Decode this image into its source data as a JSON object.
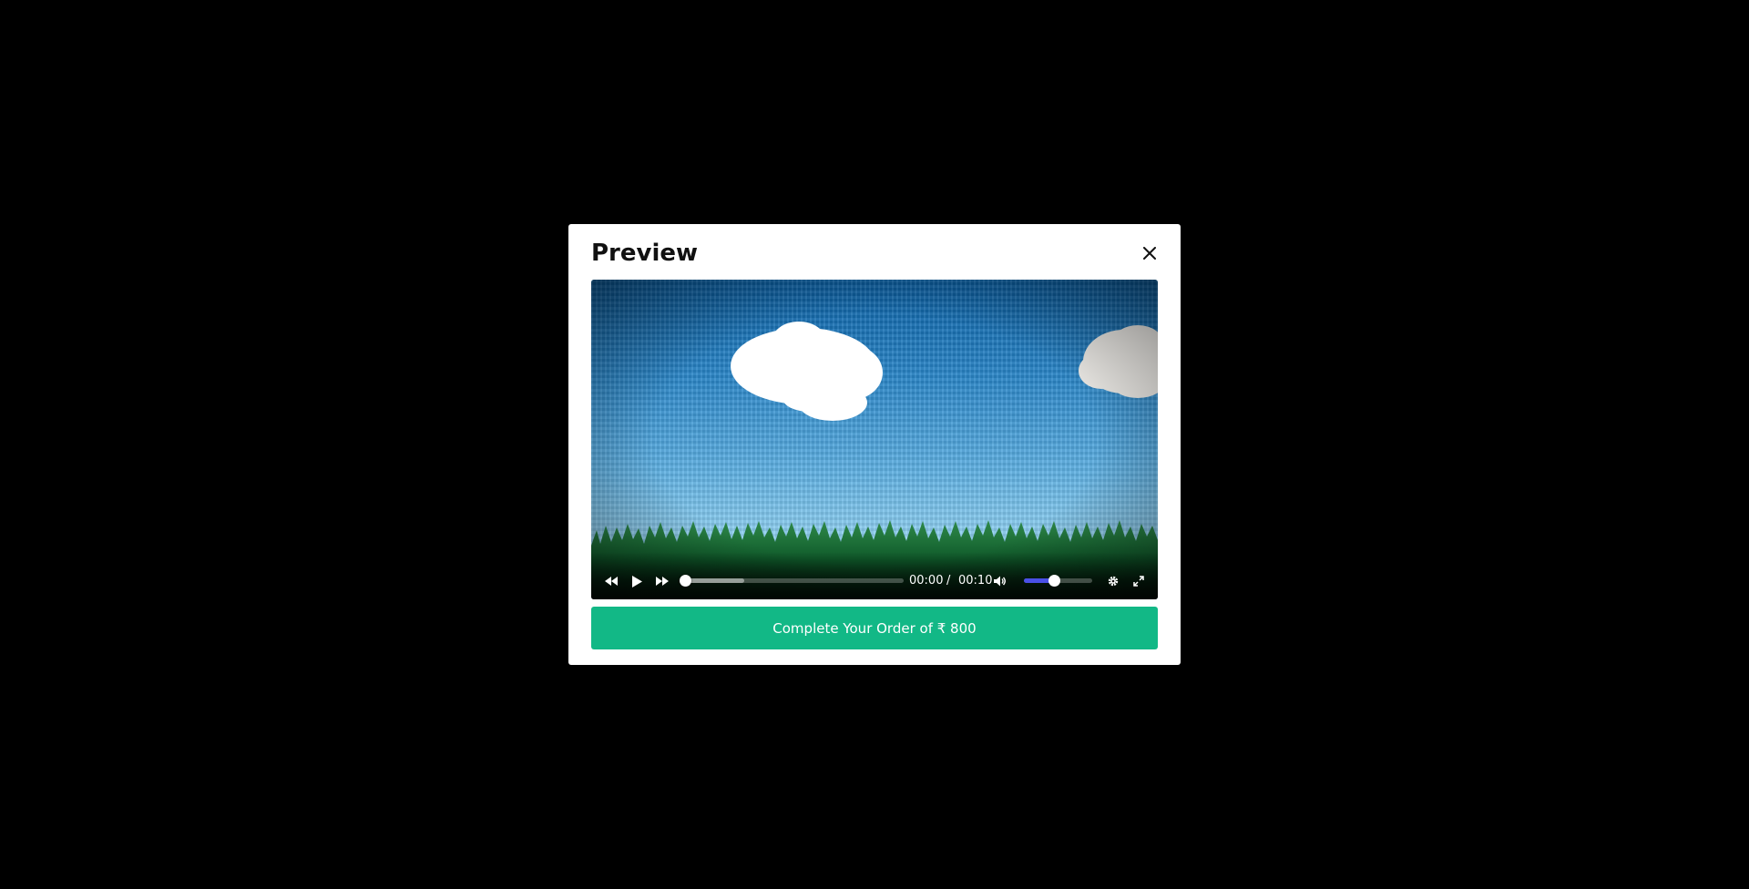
{
  "modal": {
    "title": "Preview"
  },
  "player": {
    "current_time": "00:00",
    "separator": "/",
    "duration": "00:10",
    "progress_fraction": 0.0,
    "buffered_fraction": 0.27,
    "volume_fraction": 0.44,
    "volume_color": "#4a50e6"
  },
  "order_button": {
    "label": "Complete Your Order of ₹ 800",
    "color": "#12b886"
  },
  "icons": {
    "close": "close-icon",
    "rewind": "rewind-icon",
    "play": "play-icon",
    "fast_forward": "fast-forward-icon",
    "volume": "volume-icon",
    "settings": "gear-icon",
    "fullscreen": "fullscreen-icon"
  }
}
